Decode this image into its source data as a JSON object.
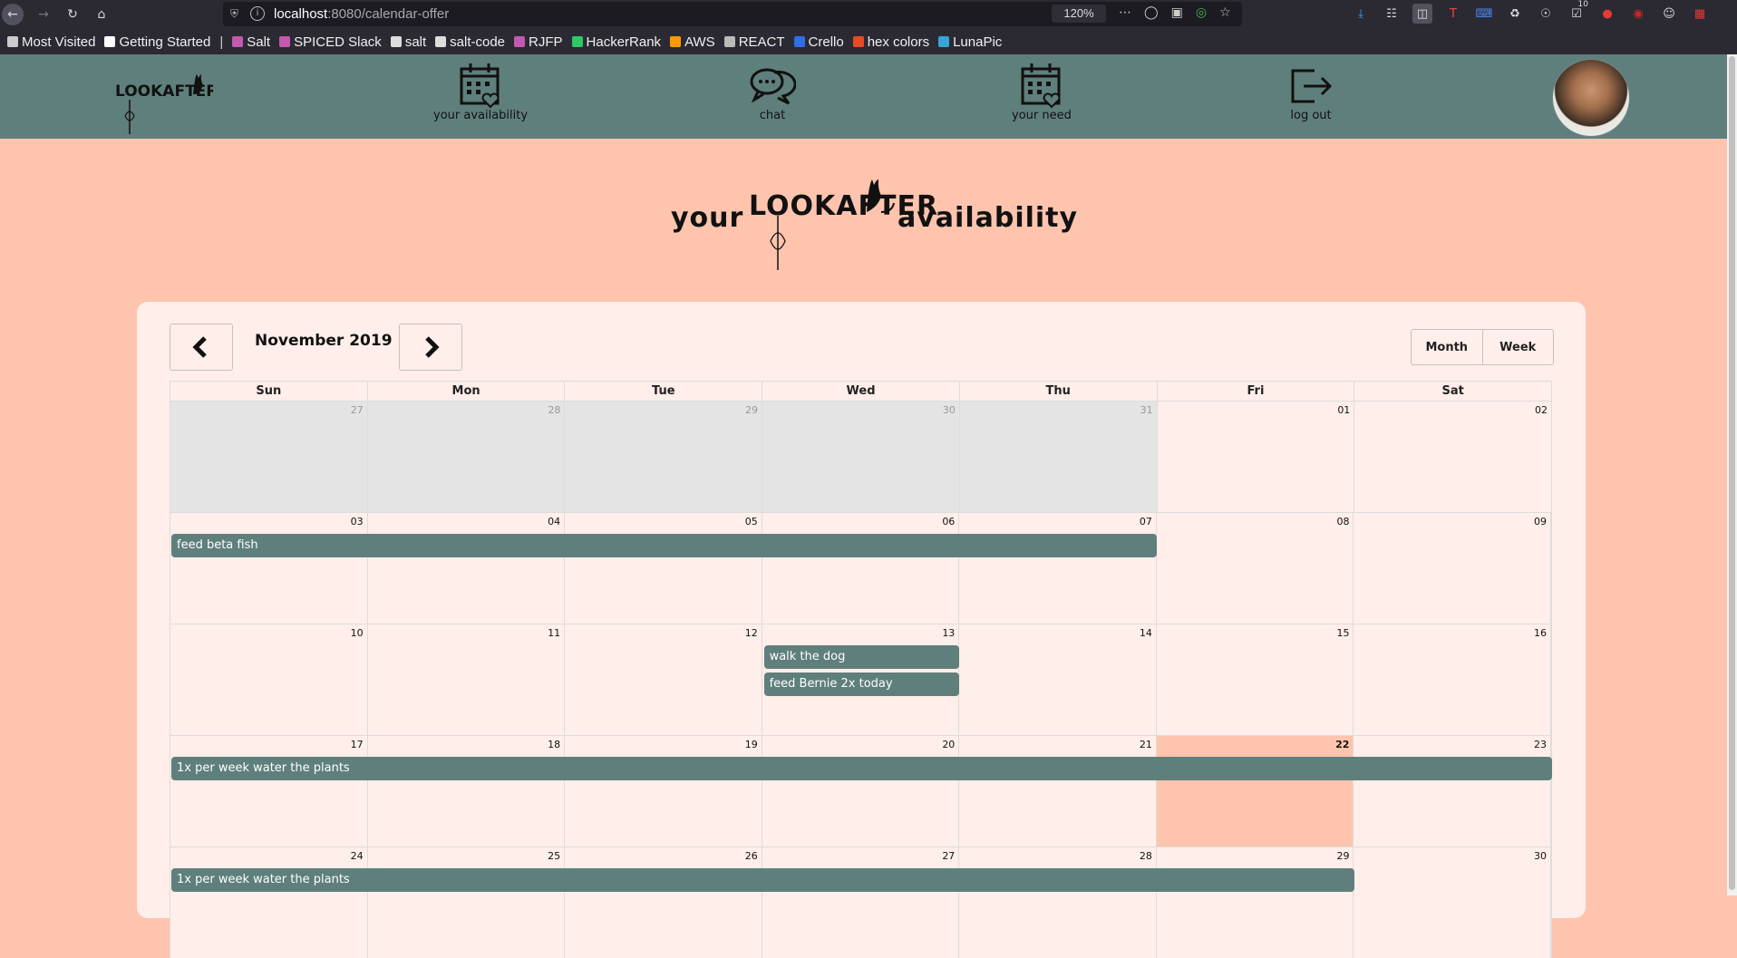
{
  "browser": {
    "url_host": "localhost",
    "url_rest": ":8080/calendar-offer",
    "zoom": "120%",
    "badge_count": "10",
    "bookmarks": [
      {
        "label": "Most Visited",
        "icon": "gear-icon"
      },
      {
        "label": "Getting Started",
        "icon": "m-icon"
      },
      {
        "label": "Salt",
        "icon": "slack-icon"
      },
      {
        "label": "SPICED Slack",
        "icon": "slack-icon"
      },
      {
        "label": "salt",
        "icon": "github-icon"
      },
      {
        "label": "salt-code",
        "icon": "github-icon"
      },
      {
        "label": "RJFP",
        "icon": "slack-icon"
      },
      {
        "label": "HackerRank",
        "icon": "hackerrank-icon"
      },
      {
        "label": "AWS",
        "icon": "aws-icon"
      },
      {
        "label": "REACT",
        "icon": "folder-icon"
      },
      {
        "label": "Crello",
        "icon": "crello-icon"
      },
      {
        "label": "hex colors",
        "icon": "hex-icon"
      },
      {
        "label": "LunaPic",
        "icon": "lunapic-icon"
      }
    ]
  },
  "header": {
    "logo_text": "LOOKAFTER",
    "nav": [
      {
        "label": "your availability",
        "icon": "calendar-heart-icon"
      },
      {
        "label": "chat",
        "icon": "chat-icon"
      },
      {
        "label": "your need",
        "icon": "calendar-heart-icon"
      },
      {
        "label": "log out",
        "icon": "logout-icon"
      }
    ]
  },
  "page_title": {
    "prefix": "your",
    "brand": "LOOKAFTER",
    "suffix": "availability"
  },
  "calendar": {
    "month_label": "November 2019",
    "views": [
      "Month",
      "Week"
    ],
    "weekdays": [
      "Sun",
      "Mon",
      "Tue",
      "Wed",
      "Thu",
      "Fri",
      "Sat"
    ],
    "weeks": [
      {
        "days": [
          "27",
          "28",
          "29",
          "30",
          "31",
          "01",
          "02"
        ],
        "off": [
          0,
          1,
          2,
          3,
          4
        ]
      },
      {
        "days": [
          "03",
          "04",
          "05",
          "06",
          "07",
          "08",
          "09"
        ],
        "off": []
      },
      {
        "days": [
          "10",
          "11",
          "12",
          "13",
          "14",
          "15",
          "16"
        ],
        "off": []
      },
      {
        "days": [
          "17",
          "18",
          "19",
          "20",
          "21",
          "22",
          "23"
        ],
        "off": [],
        "today": 5
      },
      {
        "days": [
          "24",
          "25",
          "26",
          "27",
          "28",
          "29",
          "30"
        ],
        "off": []
      }
    ],
    "events": [
      {
        "title": "feed beta fish",
        "week": 1,
        "start": 0,
        "end": 4,
        "lane": 0
      },
      {
        "title": "walk the dog",
        "week": 2,
        "start": 3,
        "end": 3,
        "lane": 0
      },
      {
        "title": "feed Bernie 2x today",
        "week": 2,
        "start": 3,
        "end": 3,
        "lane": 1
      },
      {
        "title": "1x per week water the plants",
        "week": 3,
        "start": 0,
        "end": 6,
        "lane": 0
      },
      {
        "title": "1x per week water the plants",
        "week": 4,
        "start": 0,
        "end": 5,
        "lane": 0
      }
    ]
  },
  "colors": {
    "header": "#5f7f7c",
    "page": "#ffc4ae",
    "card": "#ffeee9",
    "event": "#5f7f7c",
    "today": "#ffc4ae"
  }
}
